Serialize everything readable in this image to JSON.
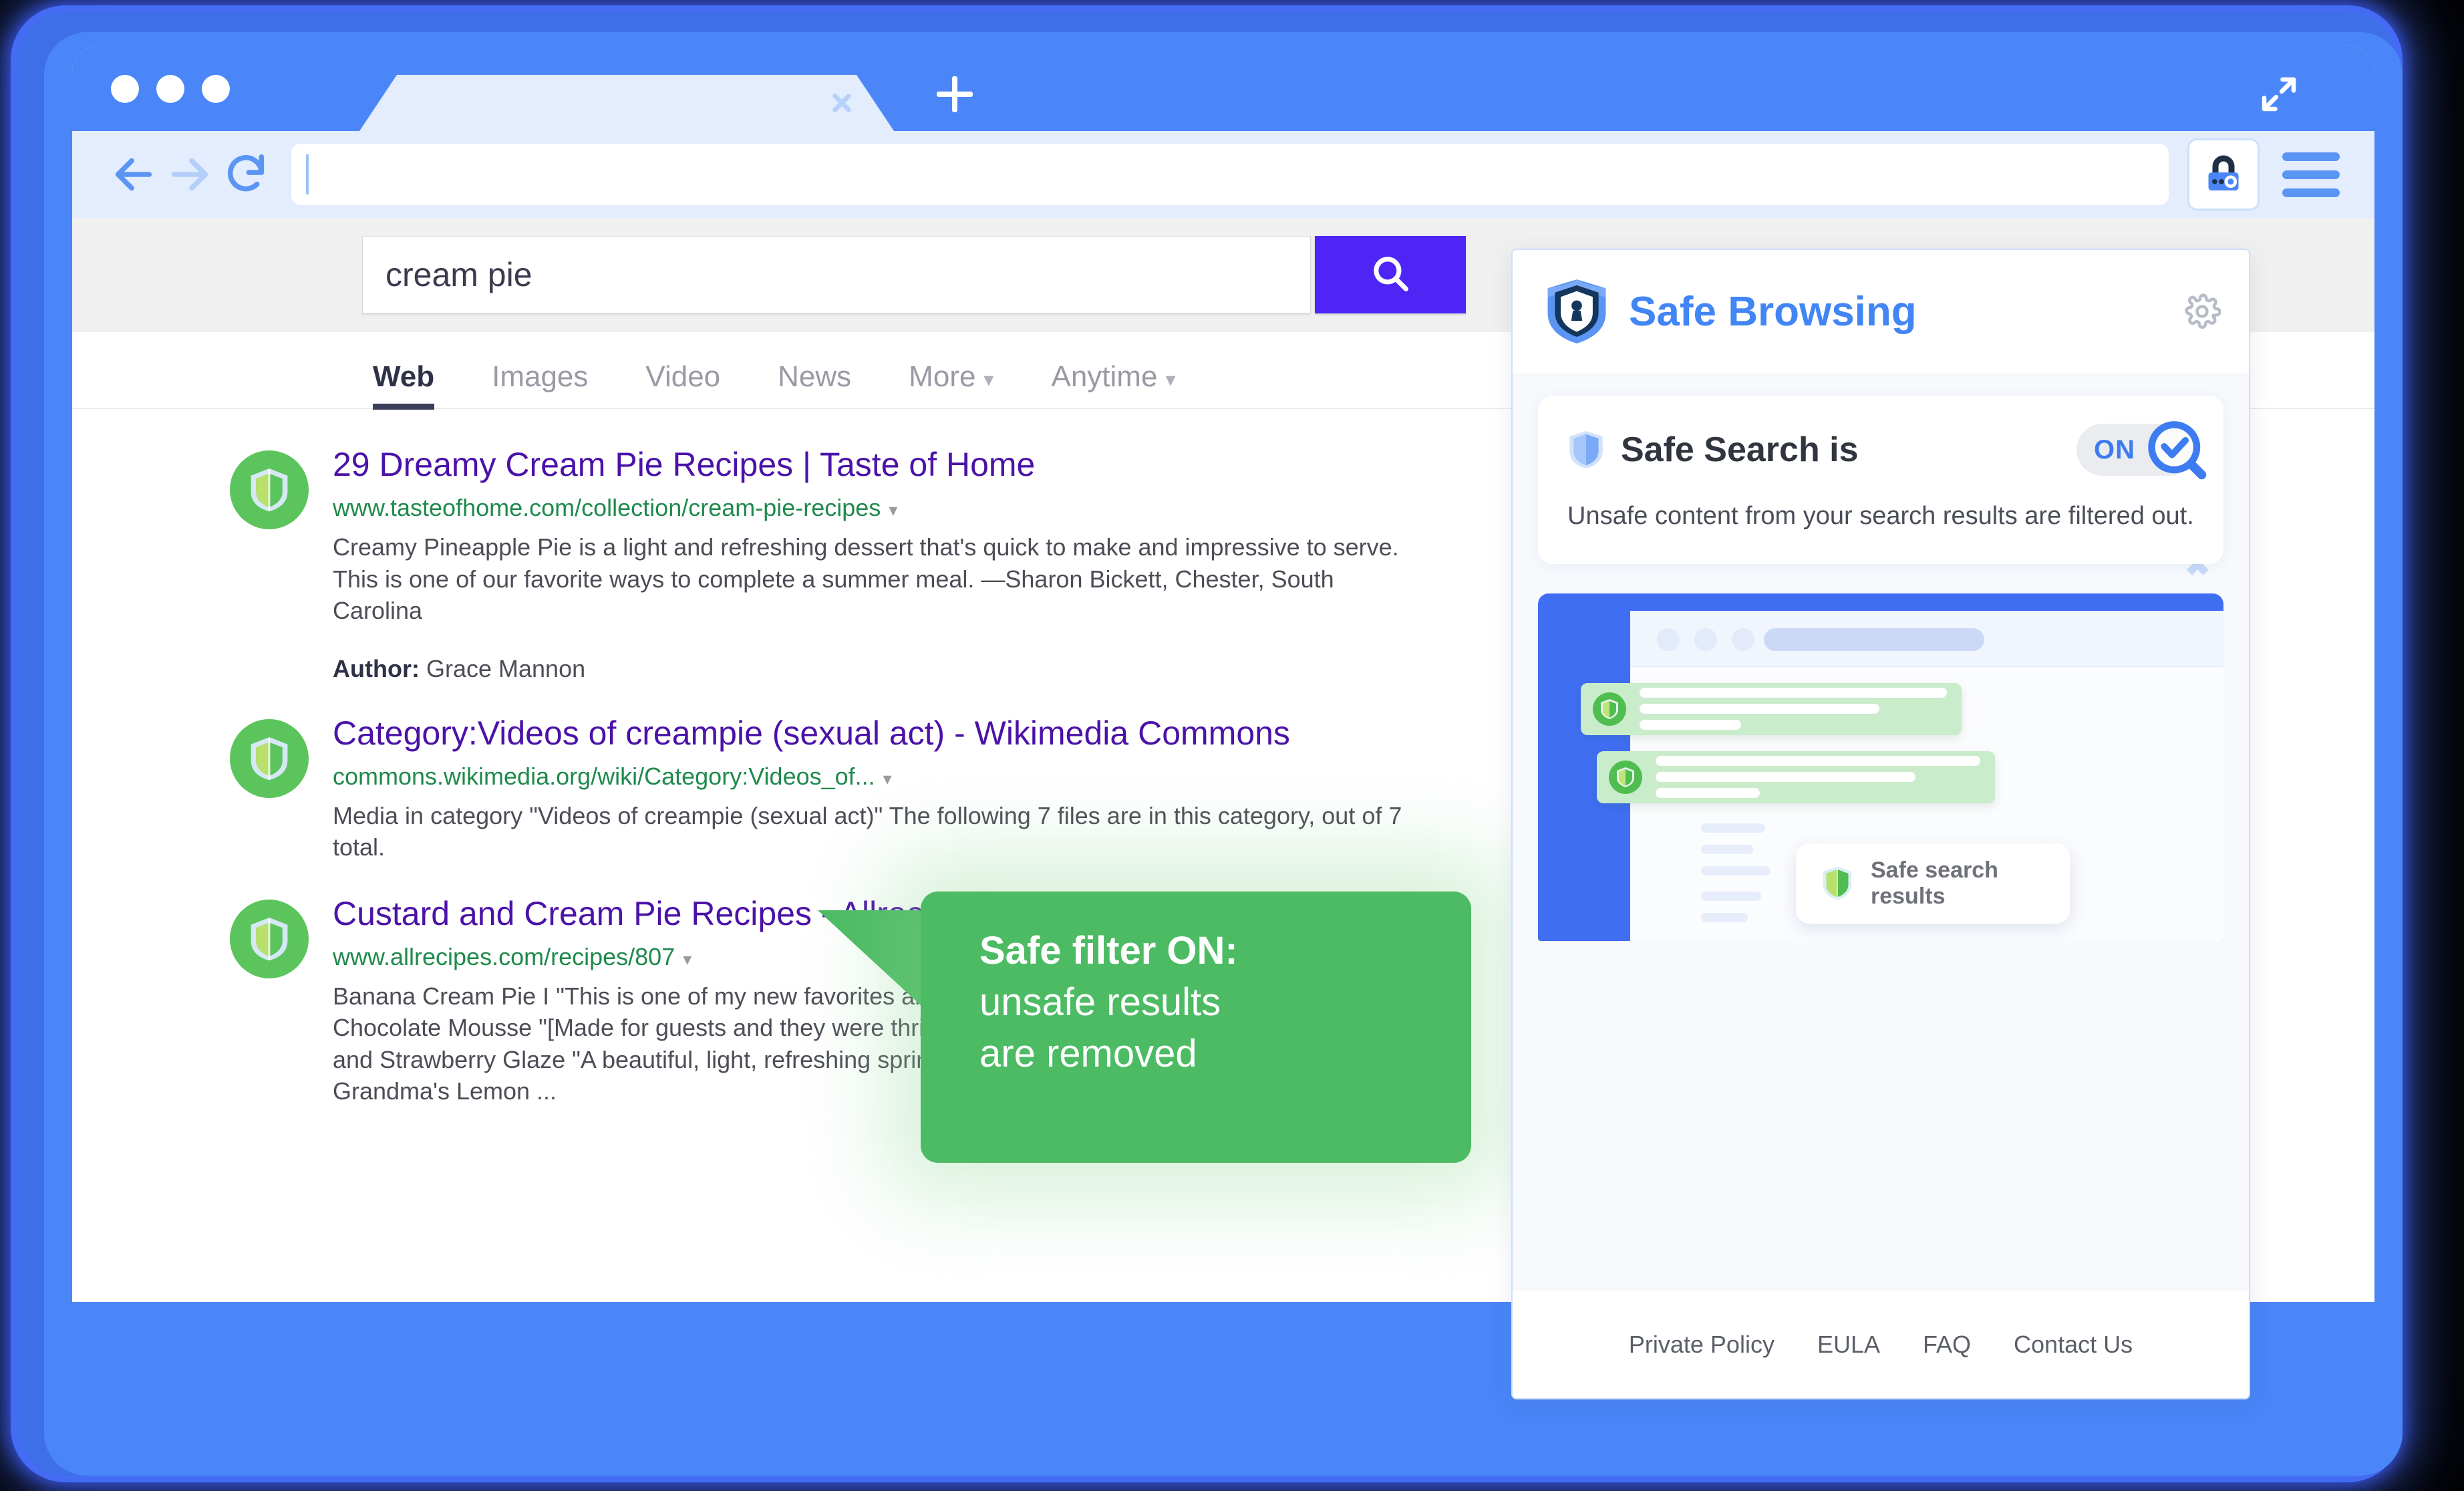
{
  "browser": {
    "window_dots_count": 3,
    "tab": {
      "title": "",
      "close_icon": "close-icon"
    },
    "new_tab_icon": "plus-icon",
    "expand_icon": "expand-icon",
    "nav": {
      "back_icon": "arrow-left-icon",
      "forward_icon": "arrow-right-icon",
      "reload_icon": "reload-icon"
    },
    "url_value": "",
    "url_placeholder": "",
    "extension_icon": "padlock-icon",
    "menu_icon": "hamburger-menu-icon"
  },
  "search": {
    "query": "cream pie",
    "placeholder": "",
    "submit_icon": "search-icon",
    "submit_color": "#4e25f5"
  },
  "result_tabs": [
    {
      "label": "Web",
      "active": true,
      "has_caret": false
    },
    {
      "label": "Images",
      "active": false,
      "has_caret": false
    },
    {
      "label": "Video",
      "active": false,
      "has_caret": false
    },
    {
      "label": "News",
      "active": false,
      "has_caret": false
    },
    {
      "label": "More",
      "active": false,
      "has_caret": true
    },
    {
      "label": "Anytime",
      "active": false,
      "has_caret": true
    }
  ],
  "results": [
    {
      "badge_icon": "green-shield-icon",
      "title": "29 Dreamy Cream Pie Recipes | Taste of Home",
      "url": "www.tasteofhome.com/collection/cream-pie-recipes",
      "snippet": "Creamy Pineapple Pie is a light and refreshing dessert that's quick to make and impressive to serve. This is one of our favorite ways to complete a summer meal. —Sharon Bickett, Chester, South Carolina",
      "meta_label": "Author:",
      "meta_value": "Grace Mannon"
    },
    {
      "badge_icon": "green-shield-icon",
      "title": "Category:Videos of creampie (sexual act) - Wikimedia Commons",
      "url": "commons.wikimedia.org/wiki/Category:Videos_of...",
      "snippet": "Media in category \"Videos of creampie (sexual act)\" The following 7 files are in this category, out of 7 total.",
      "meta_label": "",
      "meta_value": ""
    },
    {
      "badge_icon": "green-shield-icon",
      "title": "Custard and Cream Pie Recipes - Allrecipes.com",
      "url": "www.allrecipes.com/recipes/807",
      "snippet": "Banana Cream Pie I \"This is one of my new favorites and so easy to make.\" – Elise W. Death by Chocolate Mousse \"[Made for guests and they were thrilled.\" – stellarcook368. Breezy Key Lime Pie and Strawberry Glaze \"A beautiful, light, refreshing spring and summer pie.\" – naples34102. Grandma's Lemon ...",
      "meta_label": "",
      "meta_value": ""
    }
  ],
  "callout": {
    "line1": "Safe filter ON:",
    "line2": "unsafe results",
    "line3": "are removed",
    "color": "#4cbb63"
  },
  "safe_browsing_panel": {
    "logo_icon": "shield-keyhole-icon",
    "title": "Safe Browsing",
    "title_color": "#4285f4",
    "settings_icon": "gear-icon",
    "card": {
      "shield_icon": "blue-shield-icon",
      "title": "Safe Search is",
      "toggle_state": "ON",
      "toggle_knob_icon": "magnifier-check-icon",
      "description": "Unsafe content from your search results are filtered out."
    },
    "illustration": {
      "badge_icon": "green-shield-icon",
      "badge_text": "Safe search results",
      "result_shield_icon": "green-shield-icon"
    },
    "footer_links": [
      "Private Policy",
      "EULA",
      "FAQ",
      "Contact Us"
    ]
  }
}
